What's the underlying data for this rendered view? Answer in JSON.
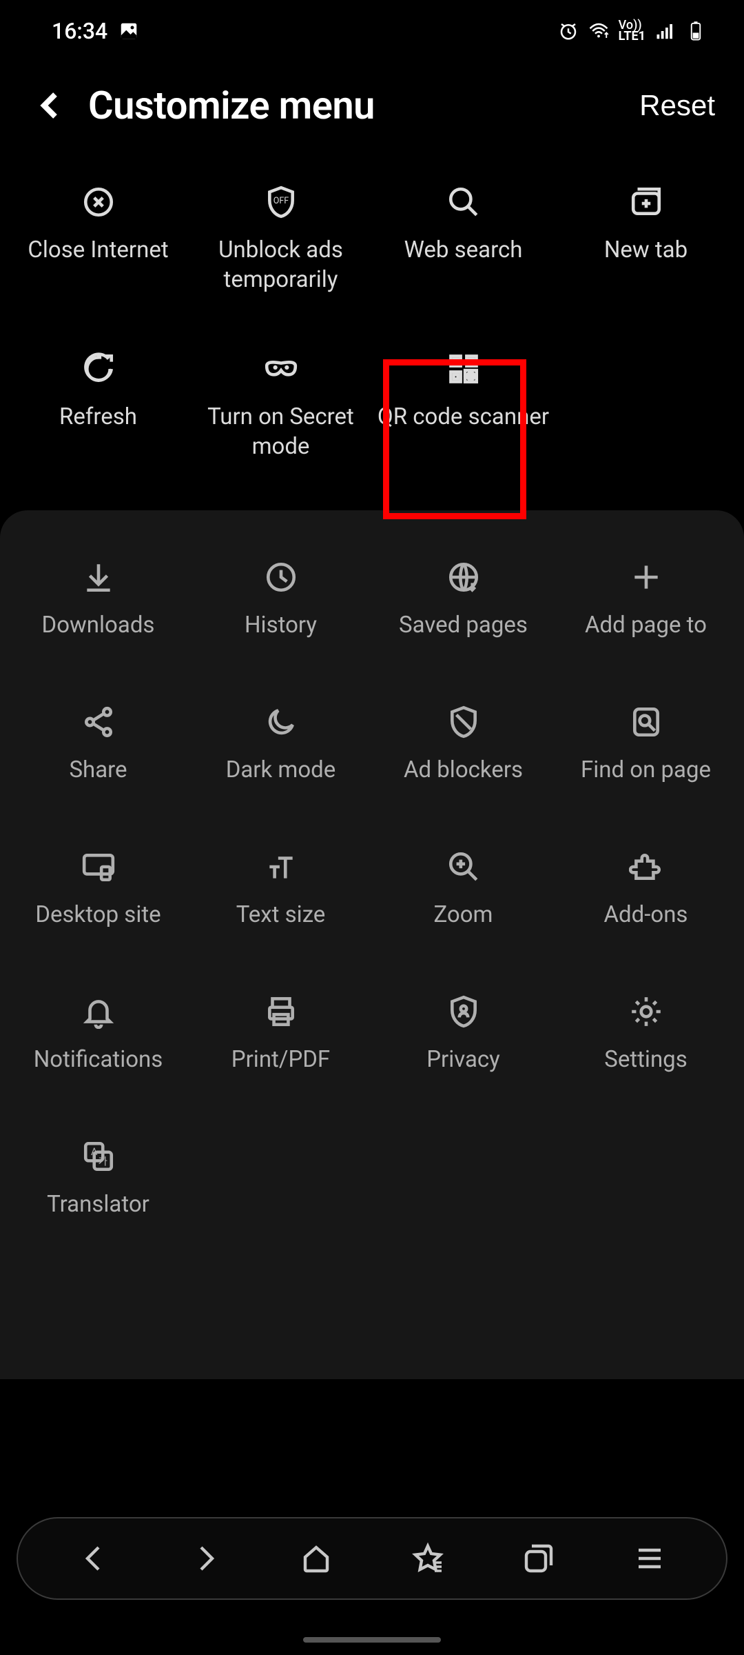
{
  "status": {
    "time": "16:34",
    "lte_label": "LTE1",
    "vo_label": "Vo))"
  },
  "header": {
    "title": "Customize menu",
    "reset": "Reset"
  },
  "top_items": [
    {
      "label": "Close Internet",
      "icon": "close-circle"
    },
    {
      "label": "Unblock ads temporarily",
      "icon": "shield-off"
    },
    {
      "label": "Web search",
      "icon": "search"
    },
    {
      "label": "New tab",
      "icon": "new-tab"
    },
    {
      "label": "Refresh",
      "icon": "refresh"
    },
    {
      "label": "Turn on Secret mode",
      "icon": "mask"
    },
    {
      "label": "QR code scanner",
      "icon": "qr",
      "highlighted": true
    }
  ],
  "bottom_items": [
    {
      "label": "Downloads",
      "icon": "download"
    },
    {
      "label": "History",
      "icon": "clock"
    },
    {
      "label": "Saved pages",
      "icon": "globe-down"
    },
    {
      "label": "Add page to",
      "icon": "plus"
    },
    {
      "label": "Share",
      "icon": "share"
    },
    {
      "label": "Dark mode",
      "icon": "moon"
    },
    {
      "label": "Ad blockers",
      "icon": "shield-block"
    },
    {
      "label": "Find on page",
      "icon": "find"
    },
    {
      "label": "Desktop site",
      "icon": "desktop"
    },
    {
      "label": "Text size",
      "icon": "text-size"
    },
    {
      "label": "Zoom",
      "icon": "zoom-in"
    },
    {
      "label": "Add-ons",
      "icon": "puzzle"
    },
    {
      "label": "Notifications",
      "icon": "bell"
    },
    {
      "label": "Print/PDF",
      "icon": "print"
    },
    {
      "label": "Privacy",
      "icon": "privacy-shield"
    },
    {
      "label": "Settings",
      "icon": "gear"
    },
    {
      "label": "Translator",
      "icon": "translate"
    }
  ],
  "nav": [
    "back",
    "forward",
    "home",
    "bookmarks",
    "tabs",
    "menu"
  ]
}
